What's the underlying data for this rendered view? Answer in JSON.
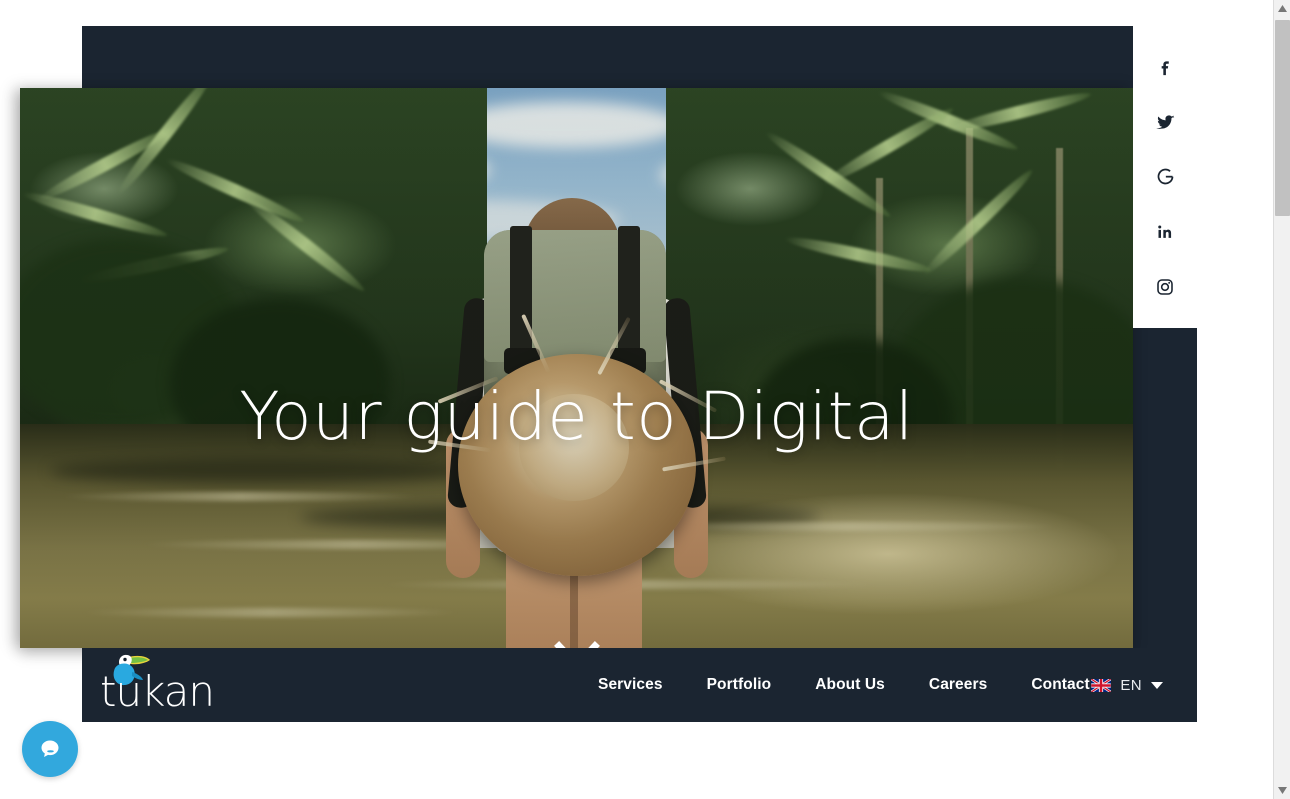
{
  "site": {
    "brand_name": "tukan",
    "brand_logo_icon": "toucan-bird-logo",
    "accent_dark": "#1b2531",
    "chat_accent": "#32a8dd"
  },
  "hero": {
    "title": "Your guide to Digital",
    "scroll_indicator_icon": "chevron-down-icon",
    "image_alt": "traveler-with-backpack-in-jungle"
  },
  "social": {
    "items": [
      {
        "name": "facebook",
        "icon": "facebook-icon",
        "glyph": "f"
      },
      {
        "name": "twitter",
        "icon": "twitter-icon",
        "glyph": "t"
      },
      {
        "name": "google",
        "icon": "google-icon",
        "glyph": "G"
      },
      {
        "name": "linkedin",
        "icon": "linkedin-icon",
        "glyph": "in"
      },
      {
        "name": "instagram",
        "icon": "instagram-icon",
        "glyph": "o"
      }
    ]
  },
  "nav": {
    "items": [
      {
        "label": "Services"
      },
      {
        "label": "Portfolio"
      },
      {
        "label": "About Us"
      },
      {
        "label": "Careers"
      },
      {
        "label": "Contact"
      }
    ],
    "language": {
      "code": "EN",
      "flag_icon": "uk-flag-icon",
      "caret_icon": "chevron-down-icon"
    }
  },
  "chat": {
    "icon": "chat-bubble-icon",
    "label": "Open chat"
  },
  "scrollbar": {
    "up_icon": "scroll-up-arrow-icon",
    "down_icon": "scroll-down-arrow-icon",
    "thumb": "scrollbar-thumb"
  }
}
